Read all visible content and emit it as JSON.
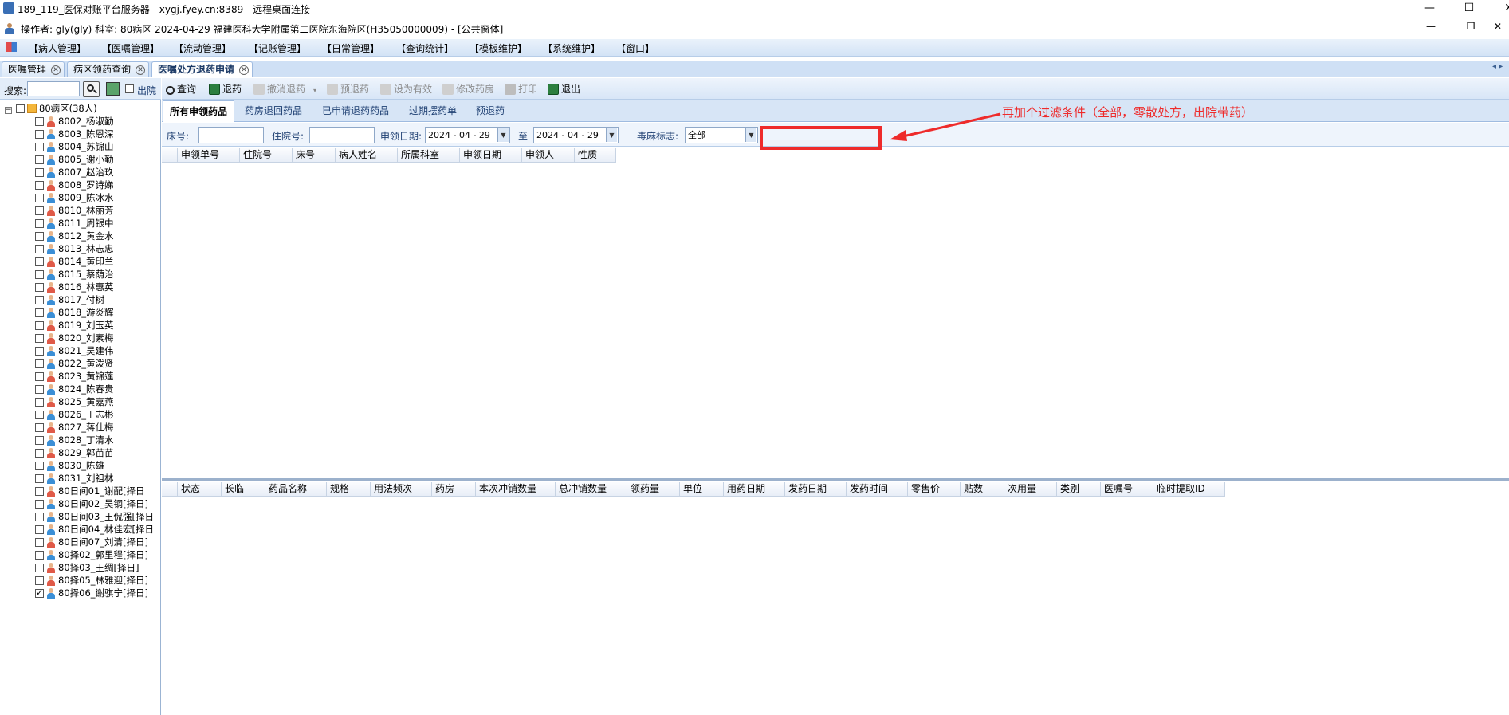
{
  "window": {
    "title": "189_119_医保对账平台服务器 - xygj.fyey.cn:8389 - 远程桌面连接",
    "minimize_glyph": "—",
    "maximize_glyph": "☐",
    "close_glyph": "✕",
    "inner_minimize_glyph": "—",
    "inner_restore_glyph": "❐",
    "inner_close_glyph": "✕"
  },
  "infobar": {
    "text": "操作者: gly(gly)  科室: 80病区  2024-04-29  福建医科大学附属第二医院东海院区(H35050000009) - [公共窗体]"
  },
  "menu": {
    "items": [
      "【病人管理】",
      "【医嘱管理】",
      "【流动管理】",
      "【记账管理】",
      "【日常管理】",
      "【查询统计】",
      "【模板维护】",
      "【系统维护】",
      "【窗口】"
    ]
  },
  "tabs": [
    {
      "label": "医嘱管理"
    },
    {
      "label": "病区领药查询"
    },
    {
      "label": "医嘱处方退药申请"
    }
  ],
  "left": {
    "search_label": "搜索:",
    "discharge_label": "出院",
    "root": "80病区(38人)",
    "patients": [
      {
        "label": "8002_杨淑勤",
        "g": "f"
      },
      {
        "label": "8003_陈恩深",
        "g": "m"
      },
      {
        "label": "8004_苏锦山",
        "g": "m"
      },
      {
        "label": "8005_谢小勤",
        "g": "m"
      },
      {
        "label": "8007_赵治玖",
        "g": "m"
      },
      {
        "label": "8008_罗诗娣",
        "g": "f"
      },
      {
        "label": "8009_陈冰水",
        "g": "m"
      },
      {
        "label": "8010_林丽芳",
        "g": "f"
      },
      {
        "label": "8011_周银中",
        "g": "m"
      },
      {
        "label": "8012_黄金水",
        "g": "m"
      },
      {
        "label": "8013_林志忠",
        "g": "m"
      },
      {
        "label": "8014_黄印兰",
        "g": "f"
      },
      {
        "label": "8015_蔡荫治",
        "g": "m"
      },
      {
        "label": "8016_林惠英",
        "g": "f"
      },
      {
        "label": "8017_付树",
        "g": "m"
      },
      {
        "label": "8018_游炎辉",
        "g": "m"
      },
      {
        "label": "8019_刘玉英",
        "g": "f"
      },
      {
        "label": "8020_刘素梅",
        "g": "f"
      },
      {
        "label": "8021_吴建伟",
        "g": "m"
      },
      {
        "label": "8022_黄泼贤",
        "g": "m"
      },
      {
        "label": "8023_黄锦莲",
        "g": "f"
      },
      {
        "label": "8024_陈春贵",
        "g": "m"
      },
      {
        "label": "8025_黄嘉燕",
        "g": "f"
      },
      {
        "label": "8026_王志彬",
        "g": "m"
      },
      {
        "label": "8027_蒋仕梅",
        "g": "f"
      },
      {
        "label": "8028_丁清水",
        "g": "m"
      },
      {
        "label": "8029_郭苗苗",
        "g": "f"
      },
      {
        "label": "8030_陈雄",
        "g": "m"
      },
      {
        "label": "8031_刘祖林",
        "g": "m"
      },
      {
        "label": "80日间01_谢配[择日",
        "g": "f"
      },
      {
        "label": "80日间02_吴钢[择日]",
        "g": "m"
      },
      {
        "label": "80日间03_王侃强[择日",
        "g": "m"
      },
      {
        "label": "80日间04_林佳宏[择日",
        "g": "m"
      },
      {
        "label": "80日间07_刘清[择日]",
        "g": "f"
      },
      {
        "label": "80择02_郭里程[择日]",
        "g": "m"
      },
      {
        "label": "80择03_王绸[择日]",
        "g": "f"
      },
      {
        "label": "80择05_林雅迎[择日]",
        "g": "f"
      },
      {
        "label": "80择06_谢骐宁[择日]",
        "g": "m",
        "checked": true
      }
    ]
  },
  "toolbar": {
    "query": "查询",
    "refund": "退药",
    "cancel_refund": "撤消退药",
    "pre_refund": "预退药",
    "set_valid": "设为有效",
    "modify_pharmacy": "修改药房",
    "print": "打印",
    "exit": "退出"
  },
  "subtabs": [
    "所有申领药品",
    "药房退回药品",
    "已申请退药药品",
    "过期摆药单",
    "预退药"
  ],
  "filter": {
    "bed_label": "床号:",
    "bed_value": "",
    "inpatient_label": "住院号:",
    "inpatient_value": "",
    "date_label": "申领日期:",
    "date_from": "2024 - 04 - 29",
    "to_label": "至",
    "date_to": "2024 - 04 - 29",
    "narcotic_label": "毒麻标志:",
    "narcotic_value": "全部"
  },
  "grid1": {
    "columns": [
      "申领单号",
      "住院号",
      "床号",
      "病人姓名",
      "所属科室",
      "申领日期",
      "申领人",
      "性质"
    ]
  },
  "grid2": {
    "columns": [
      "状态",
      "长临",
      "药品名称",
      "规格",
      "用法频次",
      "药房",
      "本次冲销数量",
      "总冲销数量",
      "领药量",
      "单位",
      "用药日期",
      "发药日期",
      "发药时间",
      "零售价",
      "贴数",
      "次用量",
      "类别",
      "医嘱号",
      "临时提取ID"
    ]
  },
  "annotation": {
    "text": "再加个过滤条件（全部，零散处方，出院带药）",
    "color": "#ee2b2b"
  }
}
